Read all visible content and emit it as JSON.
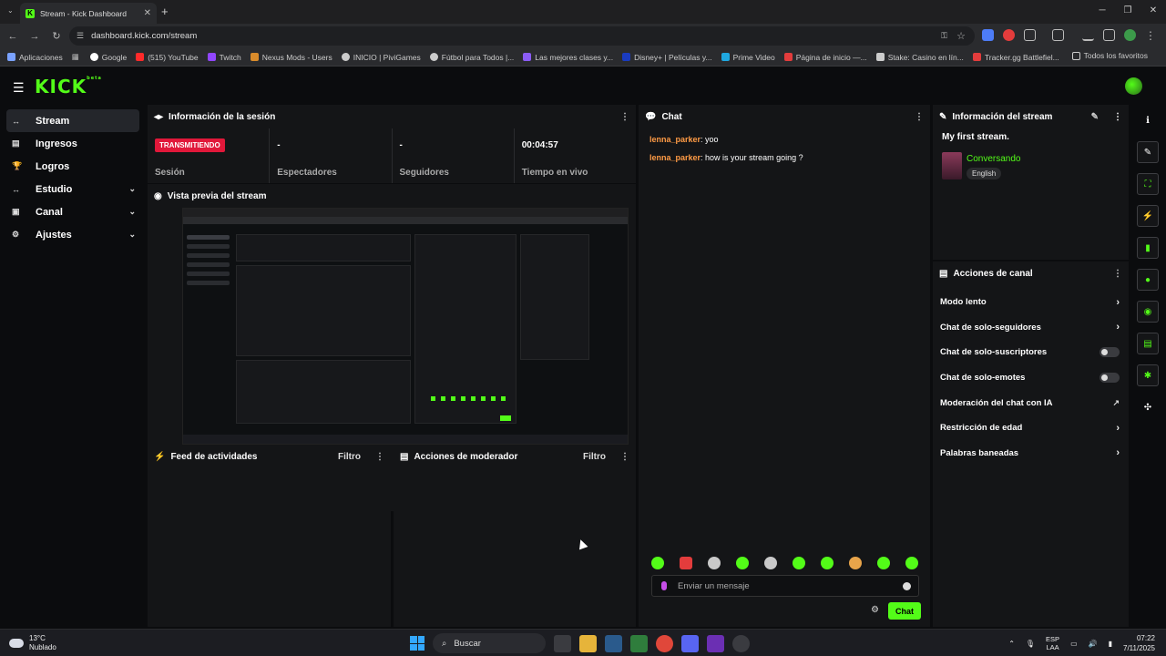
{
  "browser": {
    "tab_title": "Stream - Kick Dashboard",
    "tab_fav": "K",
    "url": "dashboard.kick.com/stream",
    "bookmarks": [
      {
        "label": "Aplicaciones",
        "color": "#7aa2ff"
      },
      {
        "label": "Google",
        "color": "#ffffff"
      },
      {
        "label": "(515) YouTube",
        "color": "#ff2a2a"
      },
      {
        "label": "Twitch",
        "color": "#9146ff"
      },
      {
        "label": "Nexus Mods - Users",
        "color": "#d98b2b"
      },
      {
        "label": "INICIO | PiviGames",
        "color": "#cccccc"
      },
      {
        "label": "Fútbol para Todos |...",
        "color": "#cccccc"
      },
      {
        "label": "Las mejores clases y...",
        "color": "#8b5cf6"
      },
      {
        "label": "Disney+ | Películas y...",
        "color": "#1a3bbf"
      },
      {
        "label": "Prime Video",
        "color": "#1fa8e0"
      },
      {
        "label": "Página de inicio —...",
        "color": "#e33c3c"
      },
      {
        "label": "Stake: Casino en lín...",
        "color": "#cccccc"
      },
      {
        "label": "Tracker.gg Battlefiel...",
        "color": "#e33c3c"
      }
    ],
    "bookmarks_all": "Todos los favoritos"
  },
  "header": {
    "logo": "KICK",
    "logo_sup": "beta"
  },
  "sidebar": {
    "items": [
      {
        "label": "Stream",
        "icon": "↔",
        "chev": ""
      },
      {
        "label": "Ingresos",
        "icon": "▤",
        "chev": ""
      },
      {
        "label": "Logros",
        "icon": "🏆",
        "chev": ""
      },
      {
        "label": "Estudio",
        "icon": "↔",
        "chev": "⌄"
      },
      {
        "label": "Canal",
        "icon": "▣",
        "chev": "⌄"
      },
      {
        "label": "Ajustes",
        "icon": "⚙",
        "chev": "⌄"
      }
    ]
  },
  "session": {
    "title": "Información de la sesión",
    "badge": "TRANSMITIENDO",
    "badge_color": "#e1183a",
    "stats": [
      {
        "value": "",
        "label": "Sesión"
      },
      {
        "value": "-",
        "label": "Espectadores"
      },
      {
        "value": "-",
        "label": "Seguidores"
      },
      {
        "value": "00:04:57",
        "label": "Tiempo en vivo"
      }
    ]
  },
  "preview": {
    "title": "Vista previa del stream"
  },
  "activity": {
    "title": "Feed de actividades",
    "filter": "Filtro"
  },
  "modactions": {
    "title": "Acciones de moderador",
    "filter": "Filtro"
  },
  "chat": {
    "title": "Chat",
    "messages": [
      {
        "user": "lenna_parker",
        "text": "yoo"
      },
      {
        "user": "lenna_parker",
        "text": "how is your stream going ?"
      }
    ],
    "input_placeholder": "Enviar un mensaje",
    "send_label": "Chat"
  },
  "stream_info": {
    "title": "Información del stream",
    "stream_title": "My first stream.",
    "category": "Conversando",
    "language": "English"
  },
  "channel_actions": {
    "title": "Acciones de canal",
    "rows": [
      {
        "label": "Modo lento",
        "control": "arrow"
      },
      {
        "label": "Chat de solo-seguidores",
        "control": "arrow"
      },
      {
        "label": "Chat de solo-suscriptores",
        "control": "toggle"
      },
      {
        "label": "Chat de solo-emotes",
        "control": "toggle"
      },
      {
        "label": "Moderación del chat con IA",
        "control": "external"
      },
      {
        "label": "Restricción de edad",
        "control": "arrow"
      },
      {
        "label": "Palabras baneadas",
        "control": "arrow"
      }
    ]
  },
  "taskbar": {
    "temp": "13°C",
    "weather": "Nublado",
    "search": "Buscar",
    "lang1": "ESP",
    "lang2": "LAA",
    "time": "07:22",
    "date": "7/11/2025"
  },
  "colors": {
    "accent": "#53fc18",
    "username": "#ff9b45"
  }
}
